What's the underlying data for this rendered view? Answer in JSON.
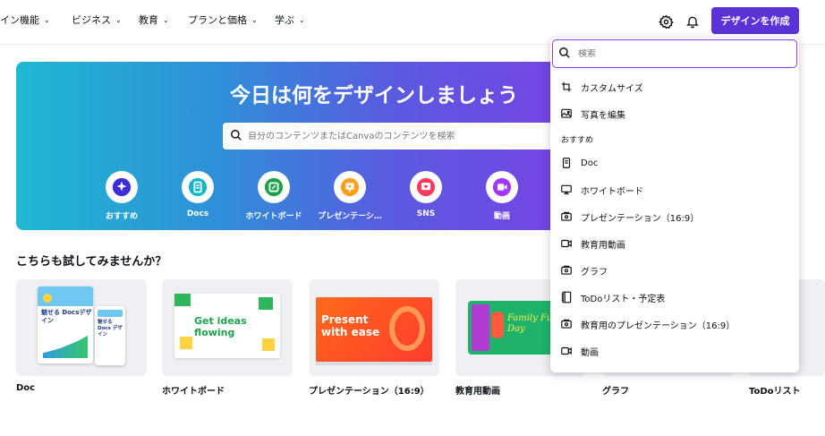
{
  "nav": {
    "items": [
      {
        "label": "イン機能",
        "icon": "chevron-down"
      },
      {
        "label": "ビジネス",
        "icon": "chevron-down"
      },
      {
        "label": "教育",
        "icon": "chevron-down"
      },
      {
        "label": "プランと価格",
        "icon": "chevron-down"
      },
      {
        "label": "学ぶ",
        "icon": "chevron-down"
      }
    ],
    "chevron": "⌄",
    "create_button": "デザインを作成"
  },
  "hero": {
    "title": "今日は何をデザインしましょう",
    "search_placeholder": "自分のコンテンツまたはCanvaのコンテンツを検索",
    "categories": [
      {
        "label": "おすすめ",
        "icon": "sparkle-icon",
        "color": "#3b2dd8"
      },
      {
        "label": "Docs",
        "icon": "doc-icon",
        "color": "#12b5cb"
      },
      {
        "label": "ホワイトボード",
        "icon": "whiteboard-icon",
        "color": "#1aa34a"
      },
      {
        "label": "プレゼンテーシ…",
        "icon": "presentation-icon",
        "color": "#ff9f1c"
      },
      {
        "label": "SNS",
        "icon": "heart-icon",
        "color": "#ff3b5c"
      },
      {
        "label": "動画",
        "icon": "video-icon",
        "color": "#a238ff"
      }
    ]
  },
  "section": {
    "title": "こちらも試してみませんか？",
    "cards": [
      {
        "label": "Doc",
        "thumb_text": "魅せる Docsデザイン",
        "thumb_text2": "魅せる Docs デザイン"
      },
      {
        "label": "ホワイトボード",
        "thumb_text": "Get ideas flowing"
      },
      {
        "label": "プレゼンテーション（16:9）",
        "thumb_text": "Present with ease"
      },
      {
        "label": "教育用動画",
        "thumb_text": "Family Fun Day"
      },
      {
        "label": "グラフ",
        "thumb_text": ""
      },
      {
        "label": "ToDoリスト",
        "thumb_text": ""
      }
    ]
  },
  "dropdown": {
    "search_placeholder": "検索",
    "items_top": [
      {
        "label": "カスタムサイズ",
        "icon": "custom-size-icon"
      },
      {
        "label": "写真を編集",
        "icon": "photo-edit-icon"
      }
    ],
    "header": "おすすめ",
    "items": [
      {
        "label": "Doc",
        "icon": "doc-icon"
      },
      {
        "label": "ホワイトボード",
        "icon": "whiteboard-icon"
      },
      {
        "label": "プレゼンテーション（16:9）",
        "icon": "presentation-icon"
      },
      {
        "label": "教育用動画",
        "icon": "video-icon"
      },
      {
        "label": "グラフ",
        "icon": "graph-icon"
      },
      {
        "label": "ToDoリスト・予定表",
        "icon": "notebook-icon"
      },
      {
        "label": "教育用のプレゼンテーション（16:9）",
        "icon": "presentation-icon"
      },
      {
        "label": "動画",
        "icon": "video-icon"
      }
    ]
  },
  "colors": {
    "accent": "#5a32d6",
    "focus": "#8b3dff"
  }
}
